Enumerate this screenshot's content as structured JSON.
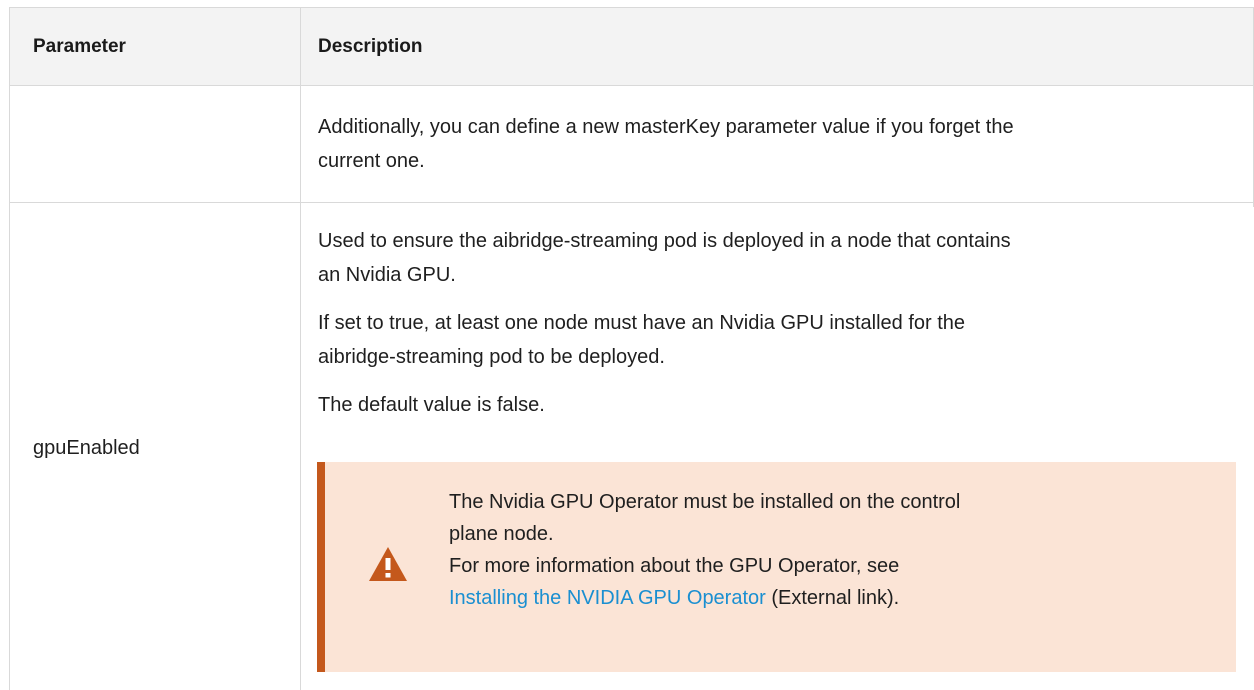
{
  "table": {
    "headers": {
      "parameter": "Parameter",
      "description": "Description"
    },
    "rows": [
      {
        "parameter": "",
        "description": {
          "line1": "Additionally, you can define a new masterKey parameter value if you forget the",
          "line2": "current one."
        }
      },
      {
        "parameter": "gpuEnabled",
        "description": {
          "p1_line1": "Used to ensure the aibridge-streaming pod is deployed in a node that contains",
          "p1_line2": "an Nvidia GPU.",
          "p2_line1": "If set to true, at least one node must have an Nvidia GPU installed for the",
          "p2_line2": "aibridge-streaming pod to be deployed.",
          "p3": "The default value is false."
        },
        "warning": {
          "icon": "warning-icon",
          "line1": "The Nvidia GPU Operator must be installed on the control",
          "line2": "plane node.",
          "line3": "For more information about the GPU Operator, see",
          "link_text": "Installing the NVIDIA GPU Operator",
          "link_suffix": " (External link).",
          "accent_color": "#c4581c",
          "background_color": "#fbe4d6",
          "link_color": "#1a8fd1"
        }
      }
    ]
  }
}
